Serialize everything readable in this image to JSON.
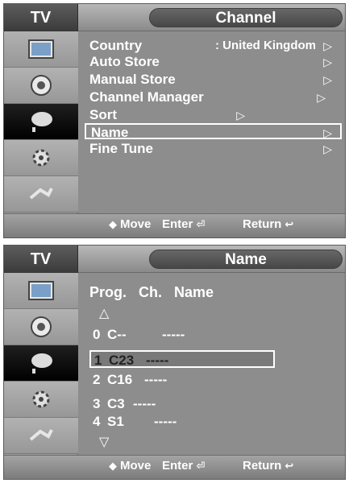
{
  "screen1": {
    "tv_label": "TV",
    "title": "Channel",
    "menu": [
      {
        "label": "Country",
        "value": ": United Kingdom",
        "arrow": "▷"
      },
      {
        "label": "Auto Store",
        "value": "",
        "arrow": "▷"
      },
      {
        "label": "Manual Store",
        "value": "",
        "arrow": "▷"
      },
      {
        "label": "Channel Manager",
        "value": "",
        "arrow": "▷"
      },
      {
        "label": "Sort",
        "value": "",
        "arrow": "▷"
      },
      {
        "label": "Name",
        "value": "",
        "arrow": "▷",
        "selected": true
      },
      {
        "label": "Fine Tune",
        "value": "",
        "arrow": "▷"
      }
    ],
    "footer": {
      "move": "Move",
      "enter": "Enter",
      "return": "Return"
    }
  },
  "screen2": {
    "tv_label": "TV",
    "title": "Name",
    "headers": {
      "prog": "Prog.",
      "ch": "Ch.",
      "name": "Name"
    },
    "up_arrow": "△",
    "down_arrow": "▽",
    "rows": [
      {
        "prog": "0",
        "ch": "C--",
        "name": "-----"
      },
      {
        "prog": "1",
        "ch": "C23",
        "name": "-----",
        "selected": true
      },
      {
        "prog": "2",
        "ch": "C16",
        "name": "-----"
      },
      {
        "prog": "3",
        "ch": "C3",
        "name": "-----"
      },
      {
        "prog": "4",
        "ch": "S1",
        "name": "-----"
      }
    ],
    "footer": {
      "move": "Move",
      "enter": "Enter",
      "return": "Return"
    }
  },
  "sidebar_icons": [
    "picture-icon",
    "sound-icon",
    "channel-icon",
    "setup-icon",
    "input-icon"
  ]
}
